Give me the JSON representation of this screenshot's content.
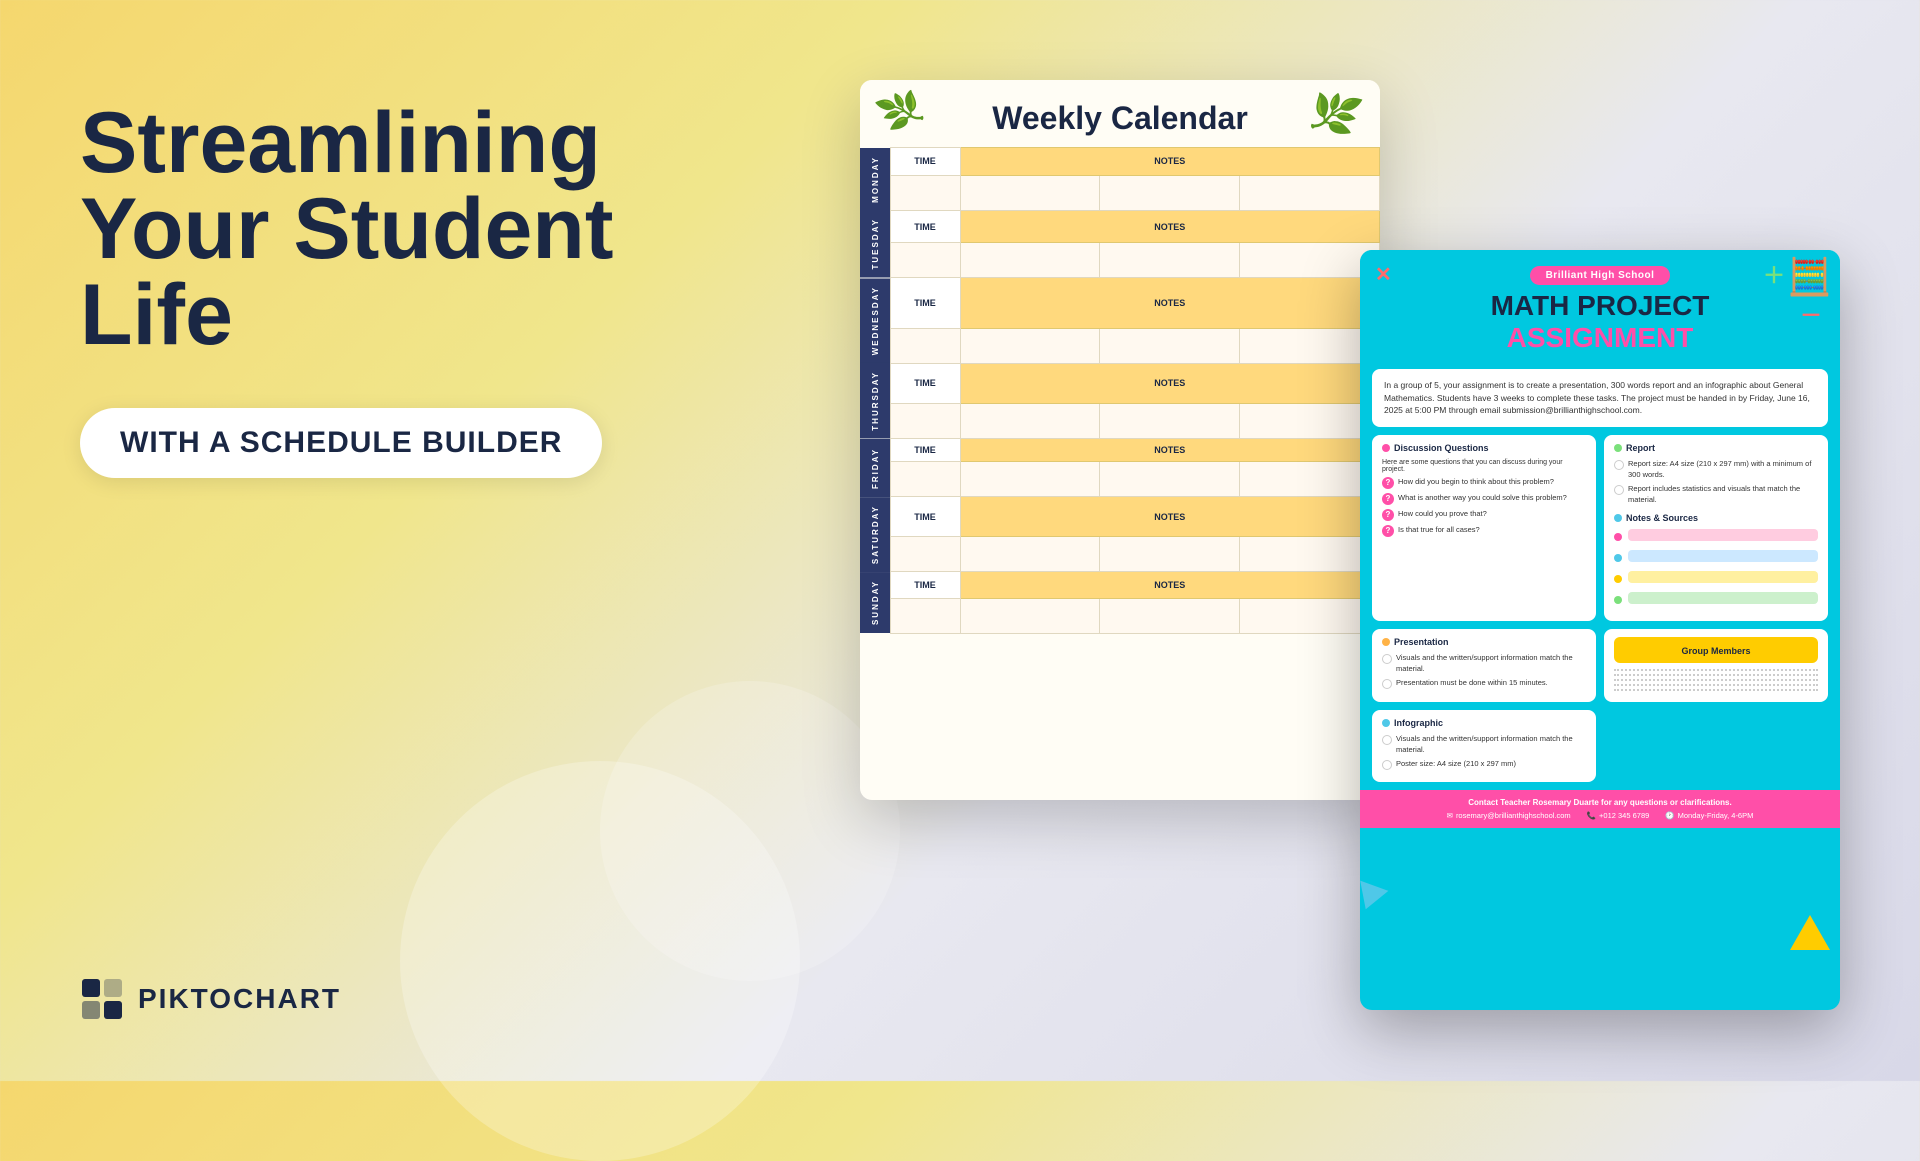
{
  "background": {
    "gradient_start": "#f5d76e",
    "gradient_end": "#d8d8e8"
  },
  "left": {
    "main_title_line1": "Streamlining",
    "main_title_line2": "Your Student Life",
    "subtitle": "WITH A SCHEDULE BUILDER"
  },
  "logo": {
    "text": "PIKTOCHART"
  },
  "weekly_calendar": {
    "title": "Weekly Calendar",
    "days": [
      "MONDAY",
      "TUESDAY",
      "WEDNESDAY",
      "THURSDAY",
      "FRIDAY",
      "SATURDAY",
      "SUNDAY"
    ],
    "col_time": "TIME",
    "col_notes": "NOTES"
  },
  "math_project": {
    "school": "Brilliant High School",
    "title_line1": "MATH PROJECT",
    "title_line2": "ASSIGNMENT",
    "description": "In a group of 5, your assignment is to create a presentation, 300 words report and an infographic about General Mathematics. Students have 3 weeks to complete these tasks. The project must be handed in by Friday, June 16, 2025 at 5:00 PM through email submission@brillianthighschool.com.",
    "sections": {
      "discussion": {
        "title": "Discussion Questions",
        "intro": "Here are some questions that you can discuss during your project.",
        "questions": [
          "How did you begin to think about this problem?",
          "What is another way you could solve this problem?",
          "How could you prove that?",
          "Is that true for all cases?"
        ]
      },
      "report": {
        "title": "Report",
        "items": [
          "Report size: A4 size (210 x 297 mm) with a minimum of 300 words.",
          "Report includes statistics and visuals that match the material."
        ]
      },
      "notes_sources": {
        "title": "Notes & Sources"
      },
      "presentation": {
        "title": "Presentation",
        "items": [
          "Visuals and the written/support information match the material.",
          "Presentation must be done within 15 minutes."
        ]
      },
      "infographic": {
        "title": "Infographic",
        "items": [
          "Visuals and the written/support information match the material.",
          "Poster size: A4 size (210 x 297 mm)"
        ]
      },
      "group_members": {
        "title": "Group Members"
      }
    },
    "footer": {
      "contact_text": "Contact Teacher Rosemary Duarte for any questions or clarifications.",
      "email": "rosemary@brillianthighschool.com",
      "phone": "+012 345 6789",
      "hours": "Monday-Friday, 4-6PM"
    }
  }
}
